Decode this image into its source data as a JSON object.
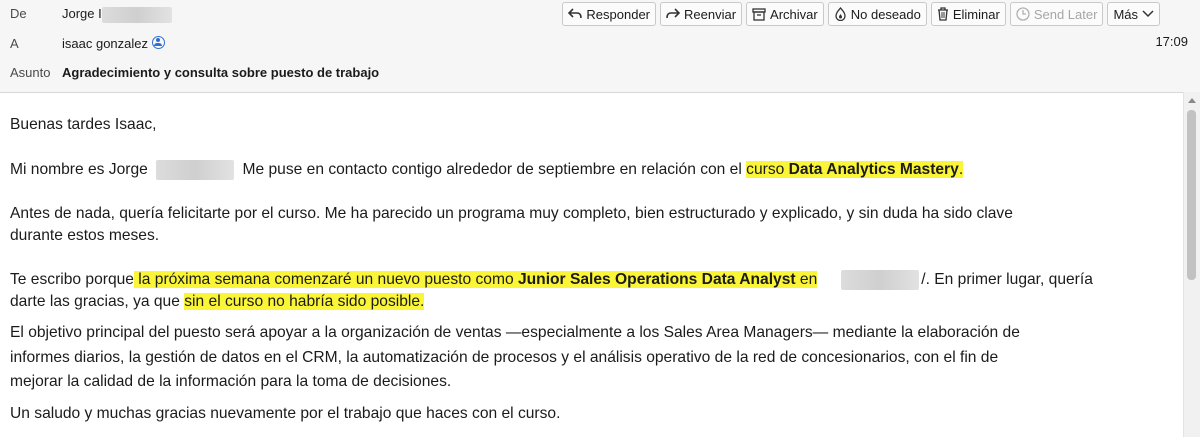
{
  "header": {
    "from_label": "De",
    "from_value": "Jorge I",
    "to_label": "A",
    "to_value": "isaac gonzalez",
    "subject_label": "Asunto",
    "subject_value": "Agradecimiento y consulta sobre puesto de trabajo",
    "time": "17:09"
  },
  "toolbar": {
    "reply": "Responder",
    "forward": "Reenviar",
    "archive": "Archivar",
    "junk": "No deseado",
    "delete": "Eliminar",
    "send_later": "Send Later",
    "more": "Más"
  },
  "body": {
    "greeting": "Buenas tardes Isaac,",
    "p1_a": "Mi nombre es Jorge",
    "p1_b": "Me puse en contacto contigo alrededor de septiembre en relación con el",
    "p1_c": "curso",
    "p1_d": "Data Analytics Mastery",
    "p1_e": ".",
    "p2_line1": "Antes de nada, quería felicitarte por el curso. Me ha parecido un programa muy completo, bien estructurado y explicado, y sin duda ha sido clave",
    "p2_line2": "durante estos meses.",
    "p3_a": "Te escribo porque",
    "p3_b": " la próxima semana comenzaré un nuevo puesto como ",
    "p3_c": "Junior Sales Operations Data Analyst",
    "p3_d": " en",
    "p3_e": "/. En primer lugar, quería",
    "p3_f": "darte las gracias, ya que",
    "p3_g": "sin el curso no habría sido posible.",
    "p4_line1": "El objetivo principal del puesto será apoyar a la organización de ventas —especialmente a los Sales Area Managers— mediante la elaboración de",
    "p4_line2": "informes diarios, la gestión de datos en el CRM, la automatización de procesos y el análisis operativo de la red de concesionarios, con el fin de",
    "p4_line3": "mejorar la calidad de la información para la toma de decisiones.",
    "closing": "Un saludo y muchas gracias nuevamente por el trabajo que haces con el curso."
  },
  "colors": {
    "highlight": "#fbf538",
    "header_bg": "#f6f6f6",
    "contact_icon": "#2f6ed3"
  },
  "icons": [
    "reply-icon",
    "forward-icon",
    "archive-icon",
    "junk-icon",
    "trash-icon",
    "clock-icon",
    "chevron-down-icon",
    "contact-icon"
  ]
}
